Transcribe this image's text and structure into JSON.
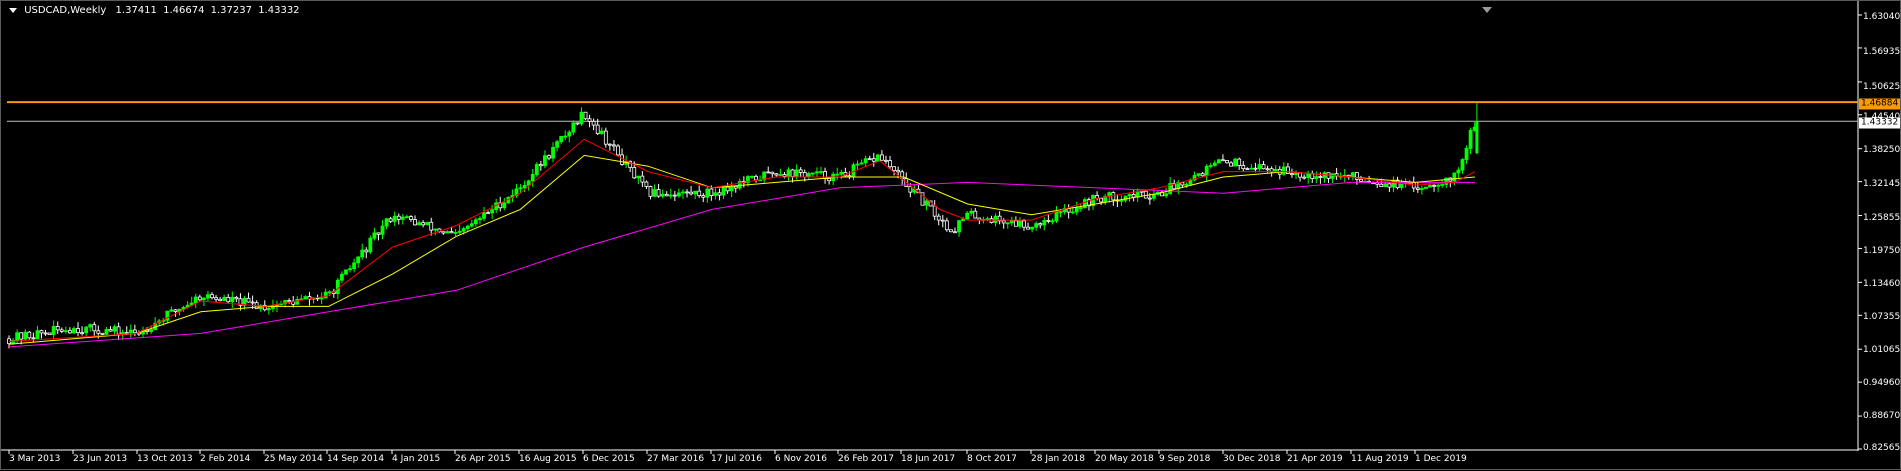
{
  "window": {
    "symbol_title": "USDCAD,Weekly",
    "ohlc": [
      "1.37411",
      "1.46674",
      "1.37237",
      "1.43332"
    ]
  },
  "colors": {
    "background": "#000000",
    "bull_candle": "#00ff00",
    "bear_candle": "#ffffff",
    "ma_fast": "#ff0000",
    "ma_slow": "#ffff00",
    "ma_long": "#ff00ff",
    "level_line": "#ff9900",
    "bid_line": "#c0c0c0",
    "axis": "#ffffff"
  },
  "price_axis": {
    "labels": [
      "1.63040",
      "1.56935",
      "1.50625",
      "1.44540",
      "1.38250",
      "1.32145",
      "1.25855",
      "1.19750",
      "1.13460",
      "1.07355",
      "1.01065",
      "0.94960",
      "0.88670",
      "0.82565"
    ]
  },
  "date_axis": {
    "labels": [
      "3 Mar 2013",
      "23 Jun 2013",
      "13 Oct 2013",
      "2 Feb 2014",
      "25 May 2014",
      "14 Sep 2014",
      "4 Jan 2015",
      "26 Apr 2015",
      "16 Aug 2015",
      "6 Dec 2015",
      "27 Mar 2016",
      "17 Jul 2016",
      "6 Nov 2016",
      "26 Feb 2017",
      "18 Jun 2017",
      "8 Oct 2017",
      "28 Jan 2018",
      "20 May 2018",
      "9 Sep 2018",
      "30 Dec 2018",
      "21 Apr 2019",
      "11 Aug 2019",
      "1 Dec 2019"
    ]
  },
  "horizontal_levels": {
    "level_price": "1.46884",
    "bid_price": "1.43332"
  },
  "chart_data": {
    "type": "candlestick",
    "symbol": "USDCAD",
    "timeframe": "Weekly",
    "y_range": [
      0.82565,
      1.6304
    ],
    "level_line": 1.46884,
    "bid_line": 1.43332,
    "price_path": [
      [
        "2013-03-03",
        1.03
      ],
      [
        "2013-06-23",
        1.05
      ],
      [
        "2013-10-13",
        1.04
      ],
      [
        "2014-02-02",
        1.11
      ],
      [
        "2014-05-25",
        1.09
      ],
      [
        "2014-09-14",
        1.11
      ],
      [
        "2015-01-04",
        1.26
      ],
      [
        "2015-04-26",
        1.22
      ],
      [
        "2015-08-16",
        1.31
      ],
      [
        "2015-12-06",
        1.45
      ],
      [
        "2016-03-27",
        1.3
      ],
      [
        "2016-07-17",
        1.3
      ],
      [
        "2016-11-06",
        1.34
      ],
      [
        "2017-02-26",
        1.33
      ],
      [
        "2017-05-07",
        1.37
      ],
      [
        "2017-06-18",
        1.32
      ],
      [
        "2017-09-10",
        1.23
      ],
      [
        "2017-10-08",
        1.26
      ],
      [
        "2018-01-28",
        1.24
      ],
      [
        "2018-05-20",
        1.29
      ],
      [
        "2018-09-09",
        1.3
      ],
      [
        "2018-12-30",
        1.36
      ],
      [
        "2019-04-21",
        1.34
      ],
      [
        "2019-08-11",
        1.33
      ],
      [
        "2019-12-01",
        1.31
      ],
      [
        "2020-02-09",
        1.33
      ],
      [
        "2020-03-01",
        1.39
      ],
      [
        "2020-03-15",
        1.43
      ]
    ],
    "ma_fast_path": [
      [
        "2013-03-03",
        1.025
      ],
      [
        "2013-10-13",
        1.04
      ],
      [
        "2014-02-02",
        1.1
      ],
      [
        "2014-05-25",
        1.09
      ],
      [
        "2014-09-14",
        1.11
      ],
      [
        "2015-01-04",
        1.2
      ],
      [
        "2015-04-26",
        1.24
      ],
      [
        "2015-08-16",
        1.3
      ],
      [
        "2015-12-06",
        1.4
      ],
      [
        "2016-03-27",
        1.34
      ],
      [
        "2016-07-17",
        1.31
      ],
      [
        "2016-11-06",
        1.33
      ],
      [
        "2017-02-26",
        1.33
      ],
      [
        "2017-05-07",
        1.36
      ],
      [
        "2017-08-20",
        1.27
      ],
      [
        "2017-10-08",
        1.25
      ],
      [
        "2018-01-28",
        1.25
      ],
      [
        "2018-05-20",
        1.29
      ],
      [
        "2018-09-09",
        1.31
      ],
      [
        "2018-12-30",
        1.34
      ],
      [
        "2019-04-21",
        1.34
      ],
      [
        "2019-08-11",
        1.33
      ],
      [
        "2019-12-01",
        1.315
      ],
      [
        "2020-02-09",
        1.32
      ],
      [
        "2020-03-15",
        1.34
      ]
    ],
    "ma_slow_path": [
      [
        "2013-03-03",
        1.02
      ],
      [
        "2013-10-13",
        1.04
      ],
      [
        "2014-02-02",
        1.08
      ],
      [
        "2014-05-25",
        1.09
      ],
      [
        "2014-09-14",
        1.09
      ],
      [
        "2015-01-04",
        1.15
      ],
      [
        "2015-04-26",
        1.22
      ],
      [
        "2015-08-16",
        1.27
      ],
      [
        "2015-12-06",
        1.37
      ],
      [
        "2016-03-27",
        1.35
      ],
      [
        "2016-07-17",
        1.31
      ],
      [
        "2016-11-06",
        1.32
      ],
      [
        "2017-02-26",
        1.33
      ],
      [
        "2017-06-18",
        1.33
      ],
      [
        "2017-10-08",
        1.28
      ],
      [
        "2018-01-28",
        1.26
      ],
      [
        "2018-05-20",
        1.28
      ],
      [
        "2018-09-09",
        1.3
      ],
      [
        "2018-12-30",
        1.33
      ],
      [
        "2019-04-21",
        1.34
      ],
      [
        "2019-08-11",
        1.33
      ],
      [
        "2019-12-01",
        1.32
      ],
      [
        "2020-03-15",
        1.33
      ]
    ],
    "ma_long_path": [
      [
        "2013-03-03",
        1.015
      ],
      [
        "2014-02-02",
        1.04
      ],
      [
        "2014-09-14",
        1.08
      ],
      [
        "2015-04-26",
        1.12
      ],
      [
        "2015-12-06",
        1.2
      ],
      [
        "2016-07-17",
        1.27
      ],
      [
        "2017-02-26",
        1.31
      ],
      [
        "2017-10-08",
        1.32
      ],
      [
        "2018-05-20",
        1.31
      ],
      [
        "2018-12-30",
        1.3
      ],
      [
        "2019-08-11",
        1.32
      ],
      [
        "2020-03-15",
        1.32
      ]
    ]
  }
}
